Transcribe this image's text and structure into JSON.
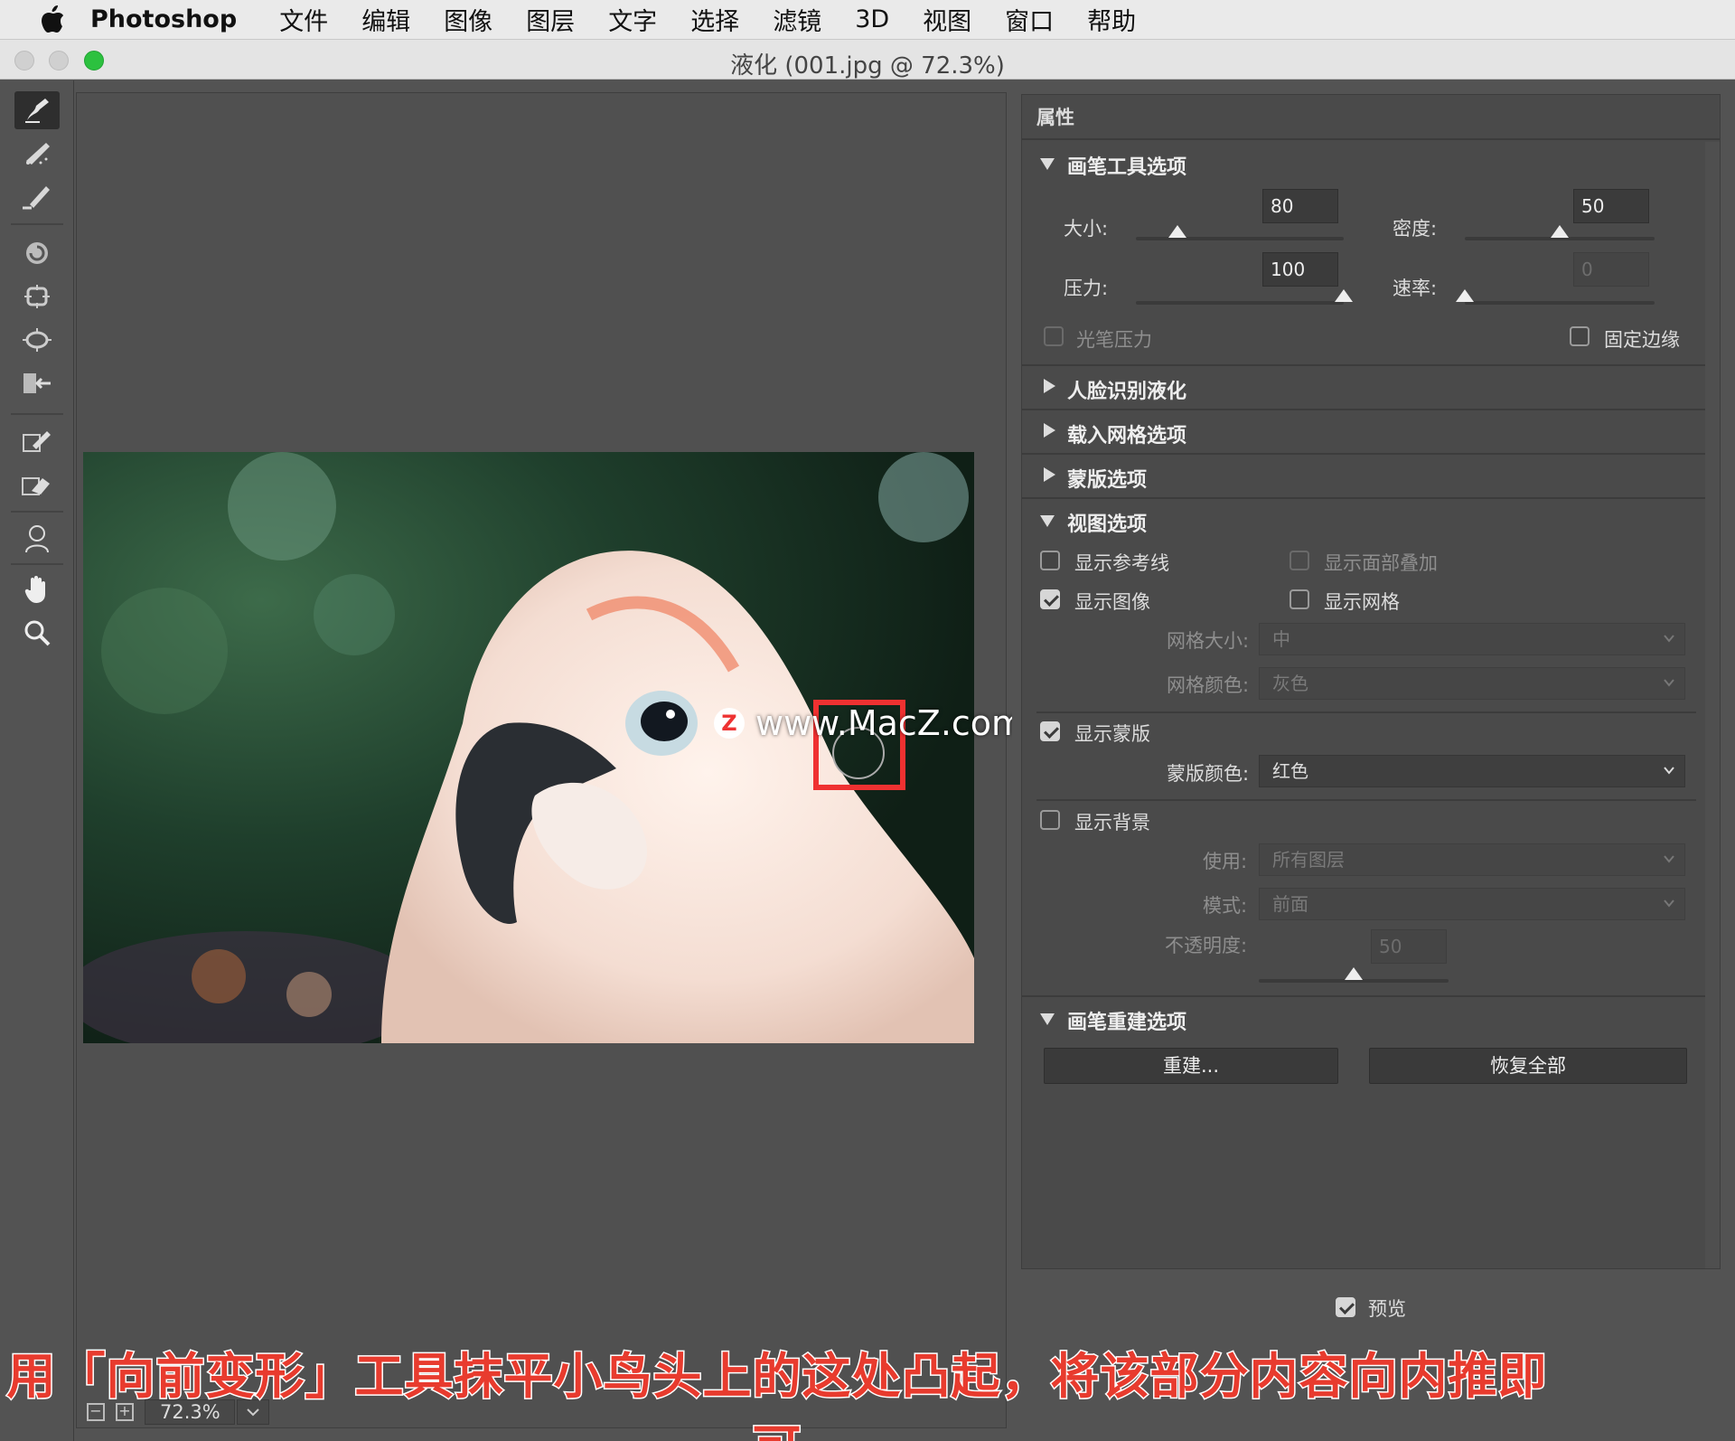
{
  "menubar": {
    "app": "Photoshop",
    "items": [
      "文件",
      "编辑",
      "图像",
      "图层",
      "文字",
      "选择",
      "滤镜",
      "3D",
      "视图",
      "窗口",
      "帮助"
    ]
  },
  "window": {
    "title": "液化 (001.jpg @ 72.3%)"
  },
  "toolbar": {
    "tools": [
      "forward-warp",
      "reconstruct",
      "smooth",
      "twirl",
      "pucker",
      "bloat",
      "push-left",
      "freeze-mask",
      "thaw-mask",
      "face",
      "hand",
      "zoom"
    ],
    "active": "forward-warp"
  },
  "canvas": {
    "zoom": "72.3%",
    "watermark": "www.MacZ.com",
    "watermark_logo": "Z"
  },
  "properties": {
    "header": "属性",
    "brush_tool_options": {
      "title": "画笔工具选项",
      "size_label": "大小:",
      "size_value": "80",
      "size_level": 0.2,
      "density_label": "密度:",
      "density_value": "50",
      "density_level": 0.5,
      "pressure_label": "压力:",
      "pressure_value": "100",
      "pressure_level": 1.0,
      "rate_label": "速率:",
      "rate_value": "0",
      "rate_level": 0.0,
      "stylus_pressure": "光笔压力",
      "pin_edges": "固定边缘"
    },
    "face_aware": "人脸识别液化",
    "load_mesh": "载入网格选项",
    "mask_options": "蒙版选项",
    "view_options": {
      "title": "视图选项",
      "show_guides": "显示参考线",
      "show_face_overlay": "显示面部叠加",
      "show_image": "显示图像",
      "show_mesh": "显示网格",
      "mesh_size_label": "网格大小:",
      "mesh_size_value": "中",
      "mesh_color_label": "网格颜色:",
      "mesh_color_value": "灰色",
      "show_mask": "显示蒙版",
      "mask_color_label": "蒙版颜色:",
      "mask_color_value": "红色",
      "show_backdrop": "显示背景",
      "use_label": "使用:",
      "use_value": "所有图层",
      "mode_label": "模式:",
      "mode_value": "前面",
      "opacity_label": "不透明度:",
      "opacity_value": "50",
      "opacity_level": 0.5
    },
    "brush_reconstruct": {
      "title": "画笔重建选项",
      "reconstruct_button": "重建...",
      "restore_all_button": "恢复全部"
    }
  },
  "preview_label": "预览",
  "subtitle": "用「向前变形」工具抹平小鸟头上的这处凸起，将该部分内容向内推即可",
  "colors": {
    "highlight": "#ef3131",
    "subtitle": "#e83b2e",
    "zoom_light": "#2cc13f"
  }
}
